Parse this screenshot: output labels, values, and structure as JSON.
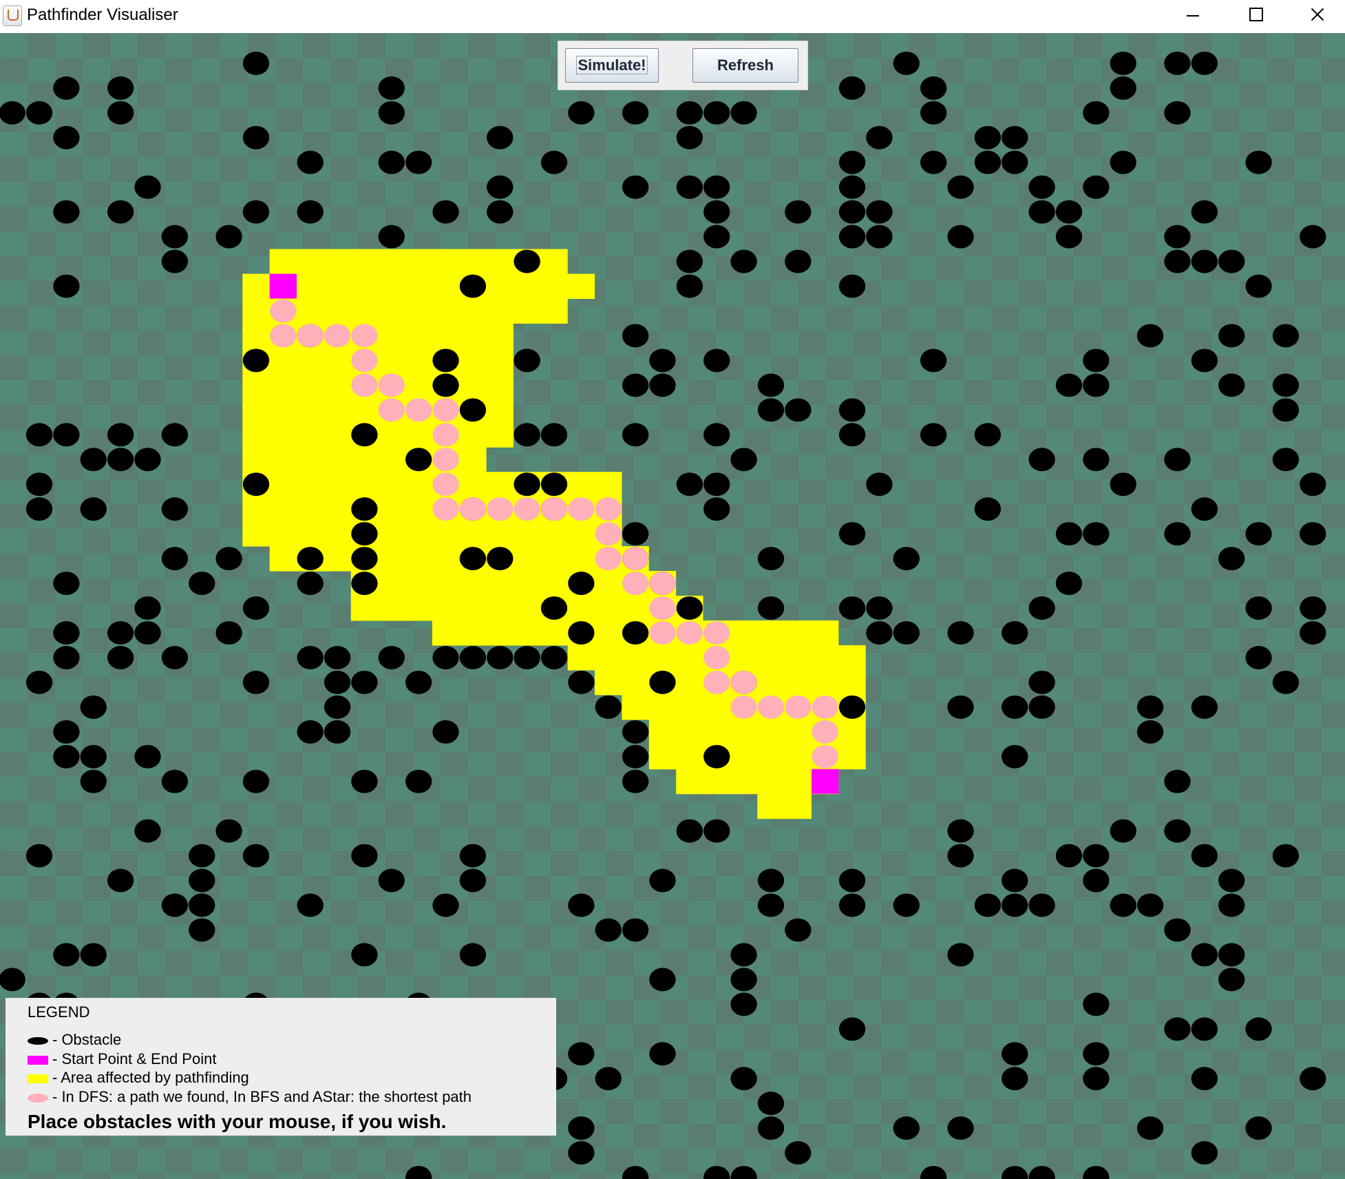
{
  "window": {
    "title": "Pathfinder Visualiser"
  },
  "toolbar": {
    "simulate_label": "Simulate!",
    "refresh_label": "Refresh"
  },
  "legend": {
    "title": "LEGEND",
    "items": [
      {
        "text": "- Obstacle",
        "icon": "obstacle-swatch"
      },
      {
        "text": "- Start Point & End Point",
        "icon": "endpoint-swatch"
      },
      {
        "text": "- Area affected by pathfinding",
        "icon": "area-swatch"
      },
      {
        "text": "- In DFS: a path we found, In BFS and AStar: the shortest path",
        "icon": "path-swatch"
      }
    ],
    "hint": "Place obstacles with your mouse, if you wish."
  },
  "grid": {
    "cols": 49,
    "rows": 46,
    "colors": {
      "obstacle": "#000000",
      "endpoint": "#ff00ff",
      "area": "#ffff00",
      "path": "#ffb0b8",
      "board": "#548878"
    },
    "start": [
      10,
      10
    ],
    "end": [
      30,
      30
    ],
    "path": [
      [
        10,
        11
      ],
      [
        10,
        12
      ],
      [
        11,
        12
      ],
      [
        12,
        12
      ],
      [
        13,
        12
      ],
      [
        13,
        13
      ],
      [
        13,
        14
      ],
      [
        14,
        14
      ],
      [
        14,
        15
      ],
      [
        15,
        15
      ],
      [
        16,
        15
      ],
      [
        16,
        16
      ],
      [
        16,
        17
      ],
      [
        16,
        18
      ],
      [
        16,
        19
      ],
      [
        17,
        19
      ],
      [
        18,
        19
      ],
      [
        19,
        19
      ],
      [
        20,
        19
      ],
      [
        21,
        19
      ],
      [
        22,
        19
      ],
      [
        22,
        20
      ],
      [
        22,
        21
      ],
      [
        23,
        21
      ],
      [
        23,
        22
      ],
      [
        24,
        22
      ],
      [
        24,
        23
      ],
      [
        24,
        24
      ],
      [
        25,
        24
      ],
      [
        26,
        24
      ],
      [
        26,
        25
      ],
      [
        26,
        26
      ],
      [
        27,
        26
      ],
      [
        27,
        27
      ],
      [
        28,
        27
      ],
      [
        29,
        27
      ],
      [
        30,
        27
      ],
      [
        30,
        28
      ],
      [
        30,
        29
      ]
    ],
    "area_rows": [
      [
        9,
        10,
        20
      ],
      [
        10,
        9,
        21
      ],
      [
        11,
        9,
        20
      ],
      [
        12,
        9,
        18
      ],
      [
        13,
        9,
        18
      ],
      [
        14,
        9,
        18
      ],
      [
        15,
        9,
        18
      ],
      [
        16,
        9,
        18
      ],
      [
        17,
        9,
        17
      ],
      [
        18,
        9,
        22
      ],
      [
        19,
        9,
        22
      ],
      [
        20,
        9,
        22
      ],
      [
        21,
        10,
        23
      ],
      [
        22,
        13,
        24
      ],
      [
        23,
        13,
        25
      ],
      [
        24,
        16,
        30
      ],
      [
        25,
        21,
        31
      ],
      [
        26,
        22,
        31
      ],
      [
        27,
        23,
        31
      ],
      [
        28,
        24,
        31
      ],
      [
        29,
        24,
        31
      ],
      [
        30,
        25,
        30
      ],
      [
        31,
        28,
        29
      ]
    ],
    "obstacles": [
      [
        9,
        1
      ],
      [
        33,
        1
      ],
      [
        41,
        1
      ],
      [
        43,
        1
      ],
      [
        44,
        1
      ],
      [
        2,
        2
      ],
      [
        4,
        2
      ],
      [
        14,
        2
      ],
      [
        31,
        2
      ],
      [
        34,
        2
      ],
      [
        41,
        2
      ],
      [
        0,
        3
      ],
      [
        1,
        3
      ],
      [
        4,
        3
      ],
      [
        14,
        3
      ],
      [
        21,
        3
      ],
      [
        23,
        3
      ],
      [
        25,
        3
      ],
      [
        26,
        3
      ],
      [
        27,
        3
      ],
      [
        34,
        3
      ],
      [
        40,
        3
      ],
      [
        43,
        3
      ],
      [
        2,
        4
      ],
      [
        9,
        4
      ],
      [
        18,
        4
      ],
      [
        25,
        4
      ],
      [
        32,
        4
      ],
      [
        36,
        4
      ],
      [
        37,
        4
      ],
      [
        11,
        5
      ],
      [
        14,
        5
      ],
      [
        15,
        5
      ],
      [
        20,
        5
      ],
      [
        31,
        5
      ],
      [
        34,
        5
      ],
      [
        36,
        5
      ],
      [
        37,
        5
      ],
      [
        41,
        5
      ],
      [
        46,
        5
      ],
      [
        5,
        6
      ],
      [
        18,
        6
      ],
      [
        23,
        6
      ],
      [
        25,
        6
      ],
      [
        26,
        6
      ],
      [
        31,
        6
      ],
      [
        35,
        6
      ],
      [
        38,
        6
      ],
      [
        40,
        6
      ],
      [
        2,
        7
      ],
      [
        4,
        7
      ],
      [
        9,
        7
      ],
      [
        11,
        7
      ],
      [
        16,
        7
      ],
      [
        18,
        7
      ],
      [
        26,
        7
      ],
      [
        29,
        7
      ],
      [
        31,
        7
      ],
      [
        32,
        7
      ],
      [
        38,
        7
      ],
      [
        39,
        7
      ],
      [
        44,
        7
      ],
      [
        6,
        8
      ],
      [
        8,
        8
      ],
      [
        14,
        8
      ],
      [
        26,
        8
      ],
      [
        31,
        8
      ],
      [
        32,
        8
      ],
      [
        35,
        8
      ],
      [
        39,
        8
      ],
      [
        43,
        8
      ],
      [
        48,
        8
      ],
      [
        6,
        9
      ],
      [
        19,
        9
      ],
      [
        25,
        9
      ],
      [
        27,
        9
      ],
      [
        29,
        9
      ],
      [
        43,
        9
      ],
      [
        44,
        9
      ],
      [
        45,
        9
      ],
      [
        2,
        10
      ],
      [
        17,
        10
      ],
      [
        25,
        10
      ],
      [
        31,
        10
      ],
      [
        46,
        10
      ],
      [
        11,
        12
      ],
      [
        23,
        12
      ],
      [
        42,
        12
      ],
      [
        45,
        12
      ],
      [
        47,
        12
      ],
      [
        9,
        13
      ],
      [
        16,
        13
      ],
      [
        19,
        13
      ],
      [
        24,
        13
      ],
      [
        26,
        13
      ],
      [
        34,
        13
      ],
      [
        40,
        13
      ],
      [
        44,
        13
      ],
      [
        16,
        14
      ],
      [
        23,
        14
      ],
      [
        24,
        14
      ],
      [
        28,
        14
      ],
      [
        39,
        14
      ],
      [
        40,
        14
      ],
      [
        45,
        14
      ],
      [
        47,
        14
      ],
      [
        17,
        15
      ],
      [
        28,
        15
      ],
      [
        29,
        15
      ],
      [
        31,
        15
      ],
      [
        47,
        15
      ],
      [
        1,
        16
      ],
      [
        2,
        16
      ],
      [
        4,
        16
      ],
      [
        6,
        16
      ],
      [
        13,
        16
      ],
      [
        19,
        16
      ],
      [
        20,
        16
      ],
      [
        23,
        16
      ],
      [
        26,
        16
      ],
      [
        31,
        16
      ],
      [
        34,
        16
      ],
      [
        36,
        16
      ],
      [
        3,
        17
      ],
      [
        4,
        17
      ],
      [
        5,
        17
      ],
      [
        15,
        17
      ],
      [
        27,
        17
      ],
      [
        38,
        17
      ],
      [
        40,
        17
      ],
      [
        43,
        17
      ],
      [
        47,
        17
      ],
      [
        1,
        18
      ],
      [
        9,
        18
      ],
      [
        19,
        18
      ],
      [
        20,
        18
      ],
      [
        25,
        18
      ],
      [
        26,
        18
      ],
      [
        32,
        18
      ],
      [
        41,
        18
      ],
      [
        48,
        18
      ],
      [
        1,
        19
      ],
      [
        3,
        19
      ],
      [
        6,
        19
      ],
      [
        13,
        19
      ],
      [
        17,
        19
      ],
      [
        20,
        19
      ],
      [
        26,
        19
      ],
      [
        36,
        19
      ],
      [
        44,
        19
      ],
      [
        13,
        20
      ],
      [
        23,
        20
      ],
      [
        31,
        20
      ],
      [
        39,
        20
      ],
      [
        40,
        20
      ],
      [
        43,
        20
      ],
      [
        46,
        20
      ],
      [
        48,
        20
      ],
      [
        6,
        21
      ],
      [
        8,
        21
      ],
      [
        11,
        21
      ],
      [
        13,
        21
      ],
      [
        17,
        21
      ],
      [
        18,
        21
      ],
      [
        23,
        21
      ],
      [
        28,
        21
      ],
      [
        33,
        21
      ],
      [
        45,
        21
      ],
      [
        2,
        22
      ],
      [
        7,
        22
      ],
      [
        11,
        22
      ],
      [
        13,
        22
      ],
      [
        21,
        22
      ],
      [
        24,
        22
      ],
      [
        39,
        22
      ],
      [
        5,
        23
      ],
      [
        9,
        23
      ],
      [
        20,
        23
      ],
      [
        25,
        23
      ],
      [
        28,
        23
      ],
      [
        31,
        23
      ],
      [
        32,
        23
      ],
      [
        38,
        23
      ],
      [
        46,
        23
      ],
      [
        48,
        23
      ],
      [
        2,
        24
      ],
      [
        4,
        24
      ],
      [
        5,
        24
      ],
      [
        8,
        24
      ],
      [
        21,
        24
      ],
      [
        23,
        24
      ],
      [
        32,
        24
      ],
      [
        33,
        24
      ],
      [
        35,
        24
      ],
      [
        37,
        24
      ],
      [
        48,
        24
      ],
      [
        2,
        25
      ],
      [
        4,
        25
      ],
      [
        6,
        25
      ],
      [
        11,
        25
      ],
      [
        12,
        25
      ],
      [
        14,
        25
      ],
      [
        16,
        25
      ],
      [
        17,
        25
      ],
      [
        18,
        25
      ],
      [
        19,
        25
      ],
      [
        20,
        25
      ],
      [
        46,
        25
      ],
      [
        1,
        26
      ],
      [
        9,
        26
      ],
      [
        12,
        26
      ],
      [
        13,
        26
      ],
      [
        15,
        26
      ],
      [
        21,
        26
      ],
      [
        24,
        26
      ],
      [
        27,
        26
      ],
      [
        38,
        26
      ],
      [
        47,
        26
      ],
      [
        3,
        27
      ],
      [
        12,
        27
      ],
      [
        22,
        27
      ],
      [
        31,
        27
      ],
      [
        35,
        27
      ],
      [
        37,
        27
      ],
      [
        38,
        27
      ],
      [
        42,
        27
      ],
      [
        44,
        27
      ],
      [
        2,
        28
      ],
      [
        11,
        28
      ],
      [
        12,
        28
      ],
      [
        16,
        28
      ],
      [
        23,
        28
      ],
      [
        42,
        28
      ],
      [
        2,
        29
      ],
      [
        3,
        29
      ],
      [
        5,
        29
      ],
      [
        23,
        29
      ],
      [
        26,
        29
      ],
      [
        37,
        29
      ],
      [
        3,
        30
      ],
      [
        6,
        30
      ],
      [
        9,
        30
      ],
      [
        13,
        30
      ],
      [
        15,
        30
      ],
      [
        23,
        30
      ],
      [
        43,
        30
      ],
      [
        5,
        32
      ],
      [
        8,
        32
      ],
      [
        25,
        32
      ],
      [
        26,
        32
      ],
      [
        35,
        32
      ],
      [
        41,
        32
      ],
      [
        43,
        32
      ],
      [
        1,
        33
      ],
      [
        7,
        33
      ],
      [
        9,
        33
      ],
      [
        13,
        33
      ],
      [
        17,
        33
      ],
      [
        35,
        33
      ],
      [
        39,
        33
      ],
      [
        40,
        33
      ],
      [
        44,
        33
      ],
      [
        47,
        33
      ],
      [
        4,
        34
      ],
      [
        7,
        34
      ],
      [
        14,
        34
      ],
      [
        17,
        34
      ],
      [
        24,
        34
      ],
      [
        28,
        34
      ],
      [
        31,
        34
      ],
      [
        37,
        34
      ],
      [
        40,
        34
      ],
      [
        45,
        34
      ],
      [
        6,
        35
      ],
      [
        7,
        35
      ],
      [
        11,
        35
      ],
      [
        16,
        35
      ],
      [
        21,
        35
      ],
      [
        28,
        35
      ],
      [
        31,
        35
      ],
      [
        33,
        35
      ],
      [
        36,
        35
      ],
      [
        37,
        35
      ],
      [
        38,
        35
      ],
      [
        41,
        35
      ],
      [
        42,
        35
      ],
      [
        45,
        35
      ],
      [
        7,
        36
      ],
      [
        22,
        36
      ],
      [
        23,
        36
      ],
      [
        29,
        36
      ],
      [
        43,
        36
      ],
      [
        2,
        37
      ],
      [
        3,
        37
      ],
      [
        13,
        37
      ],
      [
        17,
        37
      ],
      [
        27,
        37
      ],
      [
        35,
        37
      ],
      [
        44,
        37
      ],
      [
        45,
        37
      ],
      [
        0,
        38
      ],
      [
        24,
        38
      ],
      [
        27,
        38
      ],
      [
        45,
        38
      ],
      [
        1,
        39
      ],
      [
        2,
        39
      ],
      [
        9,
        39
      ],
      [
        15,
        39
      ],
      [
        27,
        39
      ],
      [
        40,
        39
      ],
      [
        31,
        40
      ],
      [
        43,
        40
      ],
      [
        44,
        40
      ],
      [
        46,
        40
      ],
      [
        21,
        41
      ],
      [
        24,
        41
      ],
      [
        37,
        41
      ],
      [
        40,
        41
      ],
      [
        20,
        42
      ],
      [
        22,
        42
      ],
      [
        27,
        42
      ],
      [
        37,
        42
      ],
      [
        40,
        42
      ],
      [
        44,
        42
      ],
      [
        48,
        42
      ],
      [
        28,
        43
      ],
      [
        21,
        44
      ],
      [
        28,
        44
      ],
      [
        33,
        44
      ],
      [
        35,
        44
      ],
      [
        42,
        44
      ],
      [
        46,
        44
      ],
      [
        21,
        45
      ],
      [
        29,
        45
      ],
      [
        44,
        45
      ],
      [
        15,
        46
      ],
      [
        23,
        46
      ],
      [
        26,
        46
      ],
      [
        27,
        46
      ],
      [
        34,
        46
      ],
      [
        37,
        46
      ],
      [
        38,
        46
      ],
      [
        40,
        46
      ]
    ]
  }
}
